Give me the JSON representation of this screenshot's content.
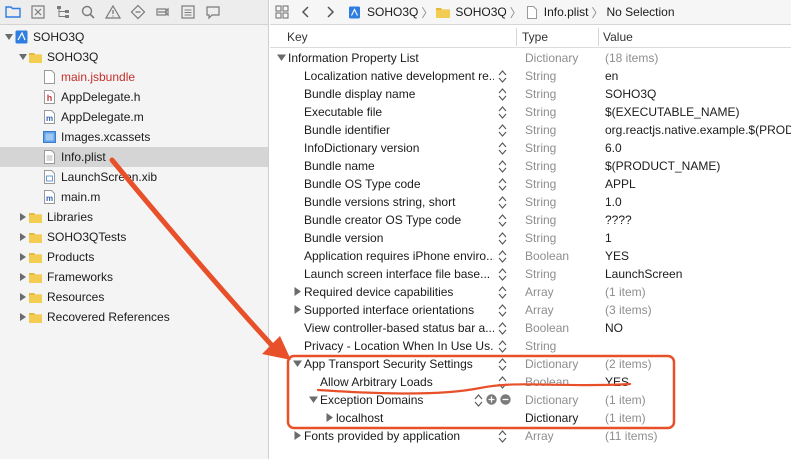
{
  "navigator": {
    "toolbar_icons": [
      "folder-icon",
      "x-square-icon",
      "hierarchy-icon",
      "search-icon",
      "warning-icon",
      "diamond-icon",
      "bookmark-icon",
      "list-icon",
      "speech-bubble-icon"
    ],
    "project": "SOHO3Q",
    "group": "SOHO3Q",
    "files": [
      {
        "label": "main.jsbundle",
        "icon": "file-icon",
        "color": "#c4302b"
      },
      {
        "label": "AppDelegate.h",
        "icon": "header-file-icon"
      },
      {
        "label": "AppDelegate.m",
        "icon": "source-file-icon"
      },
      {
        "label": "Images.xcassets",
        "icon": "asset-catalog-icon"
      },
      {
        "label": "Info.plist",
        "icon": "plist-file-icon",
        "selected": true
      },
      {
        "label": "LaunchScreen.xib",
        "icon": "xib-file-icon"
      },
      {
        "label": "main.m",
        "icon": "source-file-icon"
      }
    ],
    "groups": [
      "Libraries",
      "SOHO3QTests",
      "Products",
      "Frameworks",
      "Resources",
      "Recovered References"
    ]
  },
  "jumpbar": {
    "crumbs": [
      "SOHO3Q",
      "SOHO3Q",
      "Info.plist",
      "No Selection"
    ]
  },
  "columns": {
    "key": "Key",
    "type": "Type",
    "value": "Value"
  },
  "plist": {
    "root": {
      "key": "Information Property List",
      "type": "Dictionary",
      "value": "(18 items)"
    },
    "rows": [
      {
        "key": "Localization native development re...",
        "type": "String",
        "value": "en"
      },
      {
        "key": "Bundle display name",
        "type": "String",
        "value": "SOHO3Q"
      },
      {
        "key": "Executable file",
        "type": "String",
        "value": "$(EXECUTABLE_NAME)"
      },
      {
        "key": "Bundle identifier",
        "type": "String",
        "value": "org.reactjs.native.example.$(PRODU"
      },
      {
        "key": "InfoDictionary version",
        "type": "String",
        "value": "6.0"
      },
      {
        "key": "Bundle name",
        "type": "String",
        "value": "$(PRODUCT_NAME)"
      },
      {
        "key": "Bundle OS Type code",
        "type": "String",
        "value": "APPL"
      },
      {
        "key": "Bundle versions string, short",
        "type": "String",
        "value": "1.0"
      },
      {
        "key": "Bundle creator OS Type code",
        "type": "String",
        "value": "????"
      },
      {
        "key": "Bundle version",
        "type": "String",
        "value": "1"
      },
      {
        "key": "Application requires iPhone enviro...",
        "type": "Boolean",
        "value": "YES"
      },
      {
        "key": "Launch screen interface file base...",
        "type": "String",
        "value": "LaunchScreen"
      },
      {
        "key": "Required device capabilities",
        "type": "Array",
        "value": "(1 item)"
      },
      {
        "key": "Supported interface orientations",
        "type": "Array",
        "value": "(3 items)"
      },
      {
        "key": "View controller-based status bar a...",
        "type": "Boolean",
        "value": "NO"
      },
      {
        "key": "Privacy - Location When In Use Us...",
        "type": "String",
        "value": ""
      }
    ],
    "ats": {
      "key": "App Transport Security Settings",
      "type": "Dictionary",
      "value": "(2 items)"
    },
    "ats_children": [
      {
        "key": "Allow Arbitrary Loads",
        "type": "Boolean",
        "value": "YES"
      },
      {
        "key": "Exception Domains",
        "type": "Dictionary",
        "value": "(1 item)"
      }
    ],
    "localhost": {
      "key": "localhost",
      "type": "Dictionary",
      "value": "(1 item)"
    },
    "fonts": {
      "key": "Fonts provided by application",
      "type": "Array",
      "value": "(11 items)"
    }
  },
  "annotation": {
    "color": "#e8502a"
  }
}
